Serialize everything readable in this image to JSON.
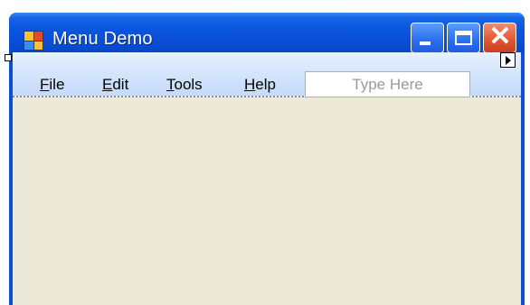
{
  "window": {
    "title": "Menu Demo"
  },
  "menu": {
    "items": [
      {
        "accel": "F",
        "rest": "ile"
      },
      {
        "accel": "E",
        "rest": "dit"
      },
      {
        "accel": "T",
        "rest": "ools"
      },
      {
        "accel": "H",
        "rest": "elp"
      }
    ],
    "new_item_placeholder": "Type Here"
  },
  "icons": {
    "app": "application-icon",
    "minimize": "minimize-icon",
    "maximize": "maximize-icon",
    "close": "close-icon",
    "smart_tag": "smart-tag-arrow-icon",
    "grip": "selection-grip"
  },
  "colors": {
    "titlebar": "#0a4fd6",
    "menubar": "#d6e6fb",
    "client": "#ece9d8",
    "close_button": "#e0552e"
  }
}
